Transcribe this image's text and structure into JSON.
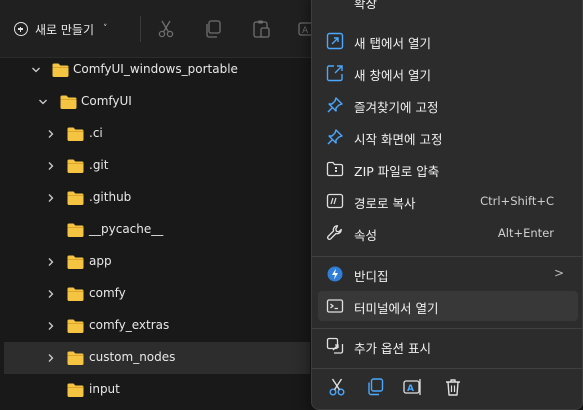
{
  "toolbar": {
    "new_label": "새로 만들기",
    "new_chevron": "˅",
    "icons": [
      "cut-icon",
      "copy-icon",
      "paste-icon",
      "rename-icon"
    ]
  },
  "tree": {
    "items": [
      {
        "label": "ComfyUI_windows_portable",
        "expanded": true
      },
      {
        "label": "ComfyUI",
        "expanded": true
      },
      {
        "label": ".ci",
        "expanded": false
      },
      {
        "label": ".git",
        "expanded": false
      },
      {
        "label": ".github",
        "expanded": false
      },
      {
        "label": "__pycache__",
        "expanded": false
      },
      {
        "label": "app",
        "expanded": false
      },
      {
        "label": "comfy",
        "expanded": false
      },
      {
        "label": "comfy_extras",
        "expanded": false
      },
      {
        "label": "custom_nodes",
        "expanded": false,
        "selected": true
      },
      {
        "label": "input",
        "expanded": false
      }
    ]
  },
  "menu": {
    "top_partial": "확장",
    "items": [
      {
        "label": "새 탭에서 열기",
        "icon": "open-in-new-tab-icon",
        "shortcut": ""
      },
      {
        "label": "새 창에서 열기",
        "icon": "open-in-new-window-icon",
        "shortcut": ""
      },
      {
        "label": "즐겨찾기에 고정",
        "icon": "pin-icon",
        "shortcut": ""
      },
      {
        "label": "시작 화면에 고정",
        "icon": "pin-icon",
        "shortcut": ""
      },
      {
        "label": "ZIP 파일로 압축",
        "icon": "zip-folder-icon",
        "shortcut": ""
      },
      {
        "label": "경로로 복사",
        "icon": "copy-path-icon",
        "shortcut": "Ctrl+Shift+C"
      },
      {
        "label": "속성",
        "icon": "wrench-icon",
        "shortcut": "Alt+Enter"
      },
      {
        "label": "반디집",
        "icon": "bandizip-icon",
        "shortcut": "",
        "submenu": ">"
      },
      {
        "label": "터미널에서 열기",
        "icon": "terminal-icon",
        "shortcut": ""
      },
      {
        "label": "추가 옵션 표시",
        "icon": "more-options-icon",
        "shortcut": ""
      }
    ],
    "quick_actions": [
      "cut-icon",
      "copy-icon",
      "rename-icon",
      "delete-icon"
    ]
  },
  "colors": {
    "background": "#191919",
    "menu_bg": "#2c2c2c",
    "folder": "#f5c443",
    "accent_blue": "#4aa8ff",
    "selected_row": "#2d2d2d"
  }
}
